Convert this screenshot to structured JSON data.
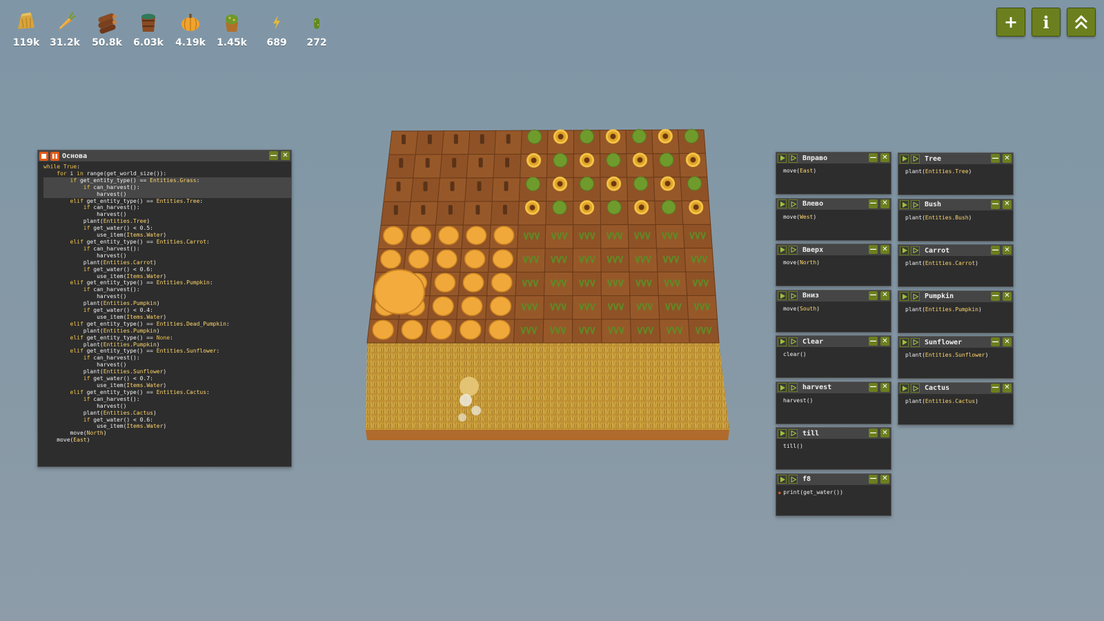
{
  "resources": [
    {
      "icon": "hay-icon",
      "value": "119k"
    },
    {
      "icon": "carrot-icon",
      "value": "31.2k"
    },
    {
      "icon": "wood-icon",
      "value": "50.8k"
    },
    {
      "icon": "water-bucket-icon",
      "value": "6.03k"
    },
    {
      "icon": "pumpkin-icon",
      "value": "4.19k"
    },
    {
      "icon": "cactus-pot-icon",
      "value": "1.45k"
    },
    {
      "icon": "power-icon",
      "value": "689"
    },
    {
      "icon": "cactus-icon",
      "value": "272"
    }
  ],
  "top_buttons": {
    "add": "+",
    "info": "i",
    "collapse": "⌃⌃"
  },
  "main_window": {
    "title": "Основа",
    "lines": [
      "while True:",
      "    for i in range(get_world_size()):",
      "        if get_entity_type() == Entities.Grass:",
      "            if can_harvest():",
      "                harvest()",
      "        elif get_entity_type() == Entities.Tree:",
      "            if can_harvest():",
      "                harvest()",
      "            plant(Entities.Tree)",
      "            if get_water() < 0.5:",
      "                use_item(Items.Water)",
      "        elif get_entity_type() == Entities.Carrot:",
      "            if can_harvest():",
      "                harvest()",
      "            plant(Entities.Carrot)",
      "            if get_water() < 0.6:",
      "                use_item(Items.Water)",
      "        elif get_entity_type() == Entities.Pumpkin:",
      "            if can_harvest():",
      "                harvest()",
      "            plant(Entities.Pumpkin)",
      "            if get_water() < 0.4:",
      "                use_item(Items.Water)",
      "        elif get_entity_type() == Entities.Dead_Pumpkin:",
      "            plant(Entities.Pumpkin)",
      "        elif get_entity_type() == None:",
      "            plant(Entities.Pumpkin)",
      "        elif get_entity_type() == Entities.Sunflower:",
      "            if can_harvest():",
      "                harvest()",
      "            plant(Entities.Sunflower)",
      "            if get_water() < 0.7:",
      "                use_item(Items.Water)",
      "        elif get_entity_type() == Entities.Cactus:",
      "            if can_harvest():",
      "                harvest()",
      "            plant(Entities.Cactus)",
      "            if get_water() < 0.6:",
      "                use_item(Items.Water)",
      "        move(North)",
      "    move(East)"
    ]
  },
  "left_column": [
    {
      "title": "Вправо",
      "code": "move(East)"
    },
    {
      "title": "Влево",
      "code": "move(West)"
    },
    {
      "title": "Вверх",
      "code": "move(North)"
    },
    {
      "title": "Вниз",
      "code": "move(South)"
    },
    {
      "title": "Clear",
      "code": "clear()"
    },
    {
      "title": "harvest",
      "code": "harvest()"
    },
    {
      "title": "till",
      "code": "till()"
    },
    {
      "title": "f8",
      "code": "print(get_water())"
    }
  ],
  "right_column": [
    {
      "title": "Tree",
      "code": "plant(Entities.Tree)"
    },
    {
      "title": "Bush",
      "code": "plant(Entities.Bush)"
    },
    {
      "title": "Carrot",
      "code": "plant(Entities.Carrot)"
    },
    {
      "title": "Pumpkin",
      "code": "plant(Entities.Pumpkin)"
    },
    {
      "title": "Sunflower",
      "code": "plant(Entities.Sunflower)"
    },
    {
      "title": "Cactus",
      "code": "plant(Entities.Cactus)"
    }
  ],
  "farm": {
    "rows_top_to_bottom": [
      "cactus x5, tree/sunflower x7",
      "cactus x5, tree/sunflower x7",
      "cactus x5, tree/sunflower x7",
      "cactus x5, tree/sunflower x7",
      "pumpkin x5, carrot x7",
      "pumpkin x5, carrot x7",
      "pumpkin x5, carrot x7",
      "pumpkin x5, carrot x7",
      "pumpkin x5, carrot x7",
      "grass x12",
      "grass x12",
      "grass x12"
    ]
  },
  "colors": {
    "button_green": "#6b7f1e",
    "stop_orange": "#e05a1a",
    "code_bg": "#2d2d2d"
  }
}
